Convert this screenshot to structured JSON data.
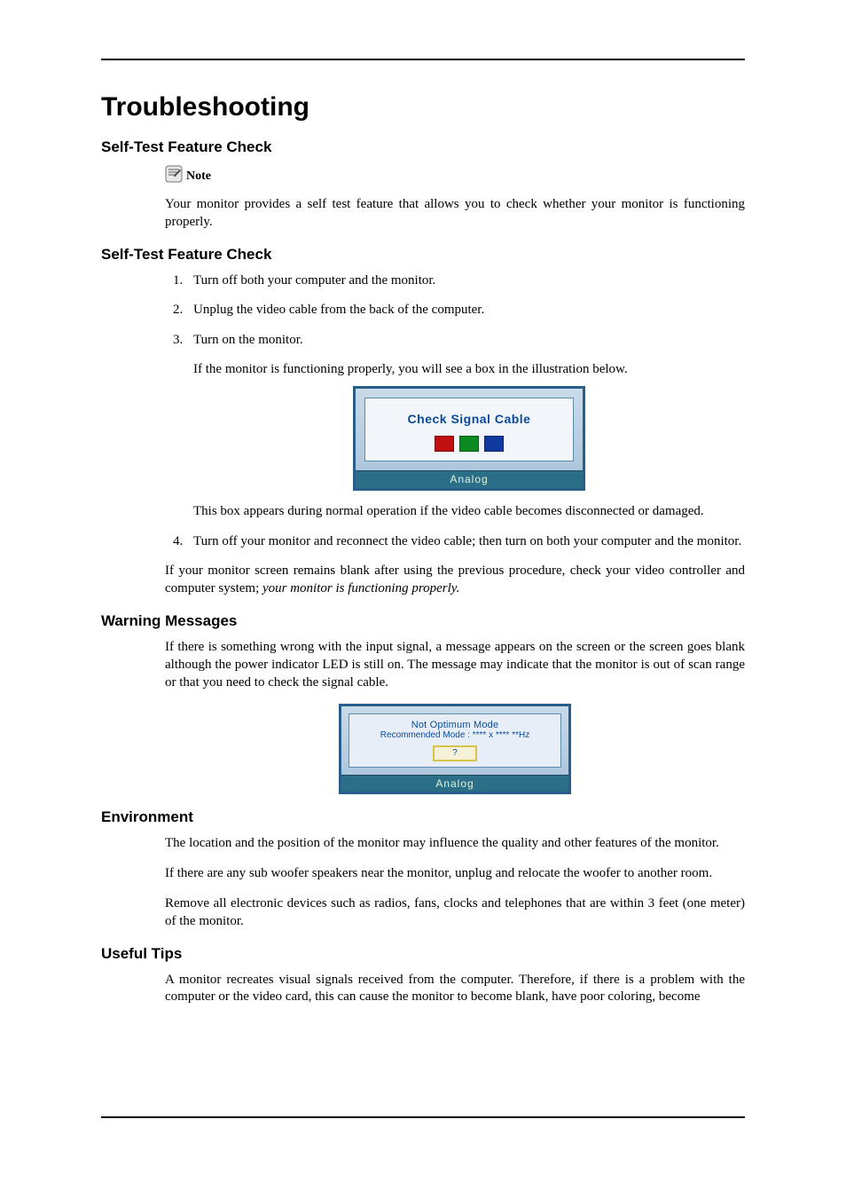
{
  "doc": {
    "title": "Troubleshooting"
  },
  "sections": {
    "selfTest1": {
      "heading": "Self-Test Feature Check",
      "noteLabel": "Note",
      "noteBody": "Your monitor provides a self test feature that allows you to check whether your monitor is functioning properly."
    },
    "selfTest2": {
      "heading": "Self-Test Feature Check",
      "steps": {
        "s1": "Turn off both your computer and the monitor.",
        "s2": "Unplug the video cable from the back of the computer.",
        "s3": "Turn on the monitor.",
        "s3_para1": "If the monitor is functioning properly, you will see a box in the illustration below.",
        "s3_para2": "This box appears during normal operation if the video cable becomes disconnected or damaged.",
        "s4": "Turn off your monitor and reconnect the video cable; then turn on both your computer and the monitor."
      },
      "closing_a": "If your monitor screen remains blank after using the previous procedure, check your video controller and computer system; ",
      "closing_b_italic": "your monitor is functioning properly."
    },
    "warning": {
      "heading": "Warning Messages",
      "body": "If there is something wrong with the input signal, a message appears on the screen or the screen goes blank although the power indicator LED is still on. The message may indicate that the monitor is out of scan range or that you need to check the signal cable."
    },
    "environment": {
      "heading": "Environment",
      "p1": "The location and the position of the monitor may influence the quality and other features of the monitor.",
      "p2": "If there are any sub woofer speakers near the monitor, unplug and relocate the woofer to another room.",
      "p3": "Remove all electronic devices such as radios, fans, clocks and telephones that are within 3 feet (one meter) of the monitor."
    },
    "tips": {
      "heading": "Useful Tips",
      "p1": "A monitor recreates visual signals received from the computer. Therefore, if there is a problem with the computer or the video card, this can cause the monitor to become blank, have poor coloring, become"
    }
  },
  "osd": {
    "checkSignal": {
      "title": "Check Signal Cable",
      "footer": "Analog"
    },
    "notOptimum": {
      "line1": "Not Optimum Mode",
      "line2": "Recommended Mode : **** x ****  **Hz",
      "question": "?",
      "footer": "Analog"
    }
  }
}
